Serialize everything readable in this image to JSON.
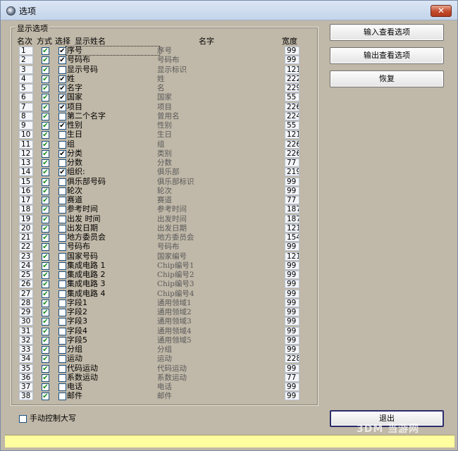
{
  "window": {
    "title": "选项",
    "close_label": "✕"
  },
  "group": {
    "label": "显示选项",
    "headers": {
      "rank": "名次",
      "mode": "方式",
      "select": "选择",
      "display_name": "显示姓名",
      "name": "名字",
      "width": "宽度"
    }
  },
  "rows": [
    {
      "rank": "1",
      "sel": true,
      "dname": "序号",
      "name": "序号",
      "width": "99"
    },
    {
      "rank": "2",
      "sel": true,
      "dname": "号码布",
      "name": "号码布",
      "width": "99"
    },
    {
      "rank": "3",
      "sel": false,
      "dname": "显示号码",
      "name": "显示标识",
      "width": "121"
    },
    {
      "rank": "4",
      "sel": true,
      "dname": "姓",
      "name": "姓",
      "width": "222"
    },
    {
      "rank": "5",
      "sel": true,
      "dname": "名字",
      "name": "名",
      "width": "229"
    },
    {
      "rank": "6",
      "sel": true,
      "dname": "国家",
      "name": "国家",
      "width": "55"
    },
    {
      "rank": "7",
      "sel": true,
      "dname": "项目",
      "name": "项目",
      "width": "226"
    },
    {
      "rank": "8",
      "sel": false,
      "dname": "第二个名字",
      "name": "曾用名",
      "width": "224"
    },
    {
      "rank": "9",
      "sel": true,
      "dname": "性别",
      "name": "性别",
      "width": "55"
    },
    {
      "rank": "10",
      "sel": false,
      "dname": "生日",
      "name": "生日",
      "width": "121"
    },
    {
      "rank": "11",
      "sel": false,
      "dname": "组",
      "name": "组",
      "width": "226"
    },
    {
      "rank": "12",
      "sel": true,
      "dname": "分类",
      "name": "类别",
      "width": "226"
    },
    {
      "rank": "13",
      "sel": false,
      "dname": "分数",
      "name": "分数",
      "width": "77"
    },
    {
      "rank": "14",
      "sel": true,
      "dname": "组织:",
      "name": "俱乐部",
      "width": "219"
    },
    {
      "rank": "15",
      "sel": false,
      "dname": "俱乐部号码",
      "name": "俱乐部标识",
      "width": "99"
    },
    {
      "rank": "16",
      "sel": false,
      "dname": "轮次",
      "name": "轮次",
      "width": "99"
    },
    {
      "rank": "17",
      "sel": false,
      "dname": "赛道",
      "name": "赛道",
      "width": "77"
    },
    {
      "rank": "18",
      "sel": false,
      "dname": "参考时间",
      "name": "参考时间",
      "width": "187"
    },
    {
      "rank": "19",
      "sel": false,
      "dname": "出发 时间",
      "name": "出发时间",
      "width": "187"
    },
    {
      "rank": "20",
      "sel": false,
      "dname": "出发日期",
      "name": "出发日期",
      "width": "121"
    },
    {
      "rank": "21",
      "sel": false,
      "dname": "地方委员会",
      "name": "地方委员会",
      "width": "154"
    },
    {
      "rank": "22",
      "sel": false,
      "dname": "号码布",
      "name": "号码布",
      "width": "99"
    },
    {
      "rank": "23",
      "sel": false,
      "dname": "国家号码",
      "name": "国家编号",
      "width": "121"
    },
    {
      "rank": "24",
      "sel": false,
      "dname": "集成电路 1",
      "name": "Chip编号1",
      "width": "99"
    },
    {
      "rank": "25",
      "sel": false,
      "dname": "集成电路 2",
      "name": "Chip编号2",
      "width": "99"
    },
    {
      "rank": "26",
      "sel": false,
      "dname": "集成电路 3",
      "name": "Chip编号3",
      "width": "99"
    },
    {
      "rank": "27",
      "sel": false,
      "dname": "集成电路 4",
      "name": "Chip编号4",
      "width": "99"
    },
    {
      "rank": "28",
      "sel": false,
      "dname": "字段1",
      "name": "通用领域1",
      "width": "99"
    },
    {
      "rank": "29",
      "sel": false,
      "dname": "字段2",
      "name": "通用领域2",
      "width": "99"
    },
    {
      "rank": "30",
      "sel": false,
      "dname": "字段3",
      "name": "通用领域3",
      "width": "99"
    },
    {
      "rank": "31",
      "sel": false,
      "dname": "字段4",
      "name": "通用领域4",
      "width": "99"
    },
    {
      "rank": "32",
      "sel": false,
      "dname": "字段5",
      "name": "通用领域5",
      "width": "99"
    },
    {
      "rank": "33",
      "sel": false,
      "dname": "分组",
      "name": "分组",
      "width": "99"
    },
    {
      "rank": "34",
      "sel": false,
      "dname": "运动",
      "name": "运动",
      "width": "228"
    },
    {
      "rank": "35",
      "sel": false,
      "dname": "代码运动",
      "name": "代码运动",
      "width": "99"
    },
    {
      "rank": "36",
      "sel": false,
      "dname": "系数运动",
      "name": "系数运动",
      "width": "77"
    },
    {
      "rank": "37",
      "sel": false,
      "dname": "电话",
      "name": "电话",
      "width": "99"
    },
    {
      "rank": "38",
      "sel": false,
      "dname": "邮件",
      "name": "邮件",
      "width": "99"
    }
  ],
  "check_glyph": "✔",
  "buttons": {
    "import": "输入查看选项",
    "export": "输出查看选项",
    "restore": "恢复",
    "exit": "退出"
  },
  "manual_caps": {
    "label": "手动控制大写",
    "checked": false
  },
  "watermark": "3DM 当游网"
}
